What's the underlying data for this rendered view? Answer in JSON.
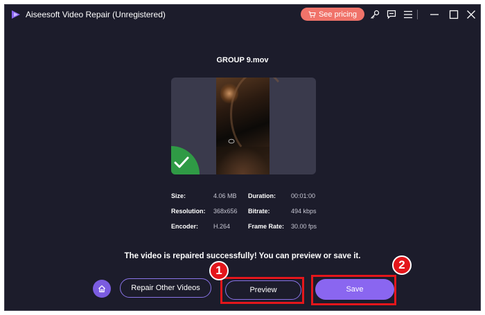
{
  "app": {
    "title": "Aiseesoft Video Repair (Unregistered)",
    "pricing_label": "See pricing",
    "accent": "#8a66f0",
    "pricing_color": "#f0736a",
    "icons": [
      "app-logo-icon",
      "cart-icon",
      "key-icon",
      "feedback-icon",
      "menu-icon",
      "minimize-icon",
      "maximize-icon",
      "close-icon"
    ]
  },
  "file": {
    "name": "GROUP 9.mov",
    "thumbnail_status": "repaired"
  },
  "info": {
    "size_label": "Size:",
    "size_value": "4.06 MB",
    "duration_label": "Duration:",
    "duration_value": "00:01:00",
    "resolution_label": "Resolution:",
    "resolution_value": "368x656",
    "bitrate_label": "Bitrate:",
    "bitrate_value": "494 kbps",
    "encoder_label": "Encoder:",
    "encoder_value": "H.264",
    "framerate_label": "Frame Rate:",
    "framerate_value": "30.00 fps"
  },
  "message": "The video is repaired successfully! You can preview or save it.",
  "actions": {
    "repair_other_label": "Repair Other Videos",
    "preview_label": "Preview",
    "save_label": "Save"
  },
  "annotations": {
    "step1": "1",
    "step2": "2",
    "highlight_color": "#e4161b"
  }
}
